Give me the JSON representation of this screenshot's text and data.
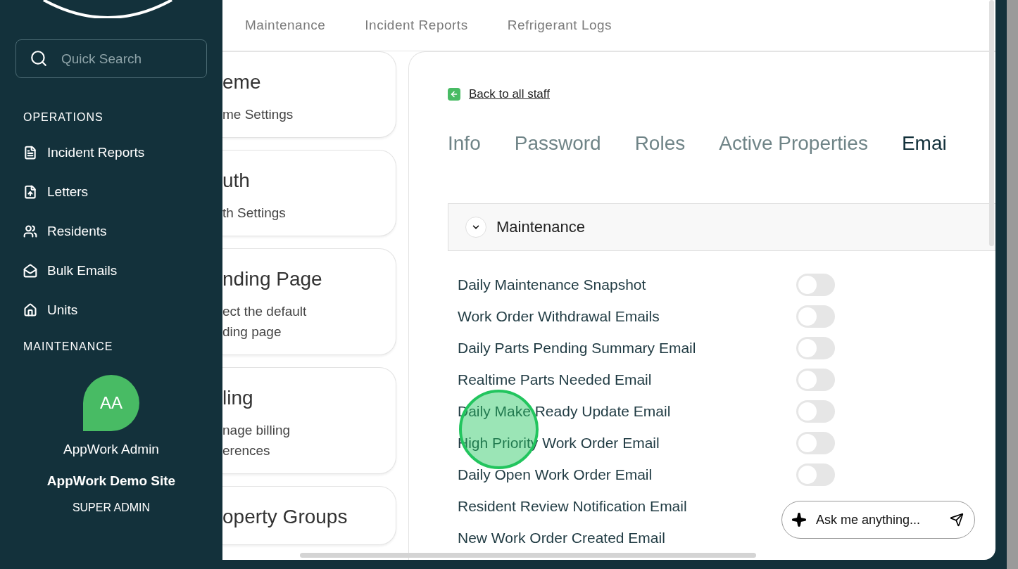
{
  "sidebar": {
    "search": {
      "placeholder": "Quick Search"
    },
    "sections": [
      {
        "title": "OPERATIONS",
        "items": [
          {
            "label": "Incident Reports"
          },
          {
            "label": "Letters"
          },
          {
            "label": "Residents"
          },
          {
            "label": "Bulk Emails"
          },
          {
            "label": "Units"
          }
        ]
      },
      {
        "title": "MAINTENANCE"
      }
    ],
    "user": {
      "initials": "AA",
      "name": "AppWork Admin",
      "site": "AppWork Demo Site",
      "role": "SUPER ADMIN"
    }
  },
  "top_nav": [
    {
      "label": "Maintenance",
      "selected": false
    },
    {
      "label": "Incident Reports",
      "selected": false
    },
    {
      "label": "Refrigerant Logs",
      "selected": false
    }
  ],
  "settings_cards": [
    {
      "title": "eme",
      "lines": [
        "me Settings"
      ]
    },
    {
      "title": "uth",
      "lines": [
        "th Settings"
      ]
    },
    {
      "title": "nding Page",
      "lines": [
        "ect the default",
        "ding page"
      ]
    },
    {
      "title": "ling",
      "lines": [
        "nage billing",
        "erences"
      ]
    },
    {
      "title": "operty Groups"
    }
  ],
  "staff": {
    "back_link": "Back to all staff",
    "tabs": [
      {
        "label": "Info",
        "selected": false
      },
      {
        "label": "Password",
        "selected": false
      },
      {
        "label": "Roles",
        "selected": false
      },
      {
        "label": "Active Properties",
        "selected": false
      },
      {
        "label": "Emai",
        "selected": true
      }
    ],
    "section": {
      "title": "Maintenance",
      "expanded": true,
      "toggles": [
        {
          "label": "Daily Maintenance Snapshot",
          "on": false
        },
        {
          "label": "Work Order Withdrawal Emails",
          "on": false
        },
        {
          "label": "Daily Parts Pending Summary Email",
          "on": false
        },
        {
          "label": "Realtime Parts Needed Email",
          "on": false
        },
        {
          "label": "Daily Make Ready Update Email",
          "on": false
        },
        {
          "label": "High Priority Work Order Email",
          "on": false
        },
        {
          "label": "Daily Open Work Order Email",
          "on": false
        },
        {
          "label": "Resident Review Notification Email"
        },
        {
          "label": "New Work Order Created Email"
        }
      ]
    }
  },
  "assistant": {
    "placeholder": "Ask me anything..."
  }
}
